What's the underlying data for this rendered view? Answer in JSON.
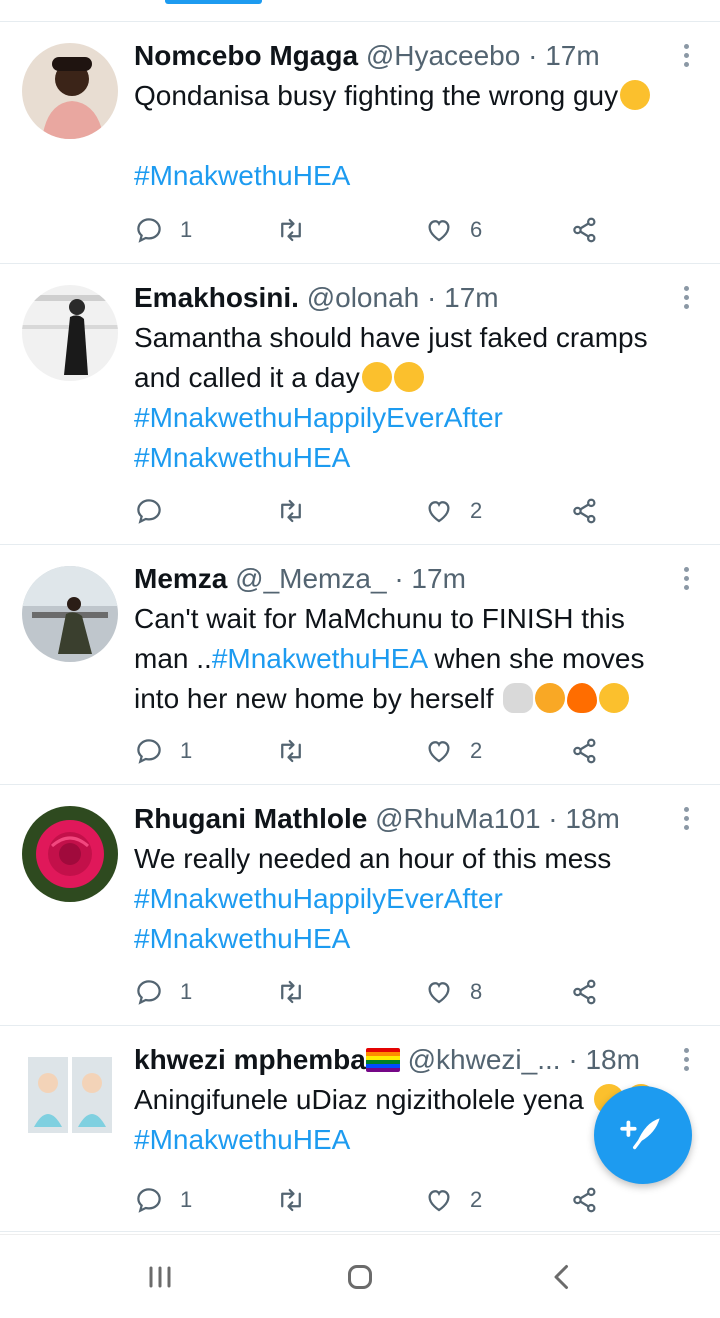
{
  "tweets": [
    {
      "name": "Nomcebo Mgaga",
      "handle": "@Hyaceebo",
      "time": "17m",
      "lines": [
        {
          "text": "Qondanisa busy fighting the wrong guy",
          "emoji": [
            "laugh"
          ]
        },
        {
          "text": "",
          "emoji": []
        },
        {
          "tag": "#MnakwethuHEA"
        }
      ],
      "replies": "1",
      "retweets": "",
      "likes": "6"
    },
    {
      "name": "Emakhosini.",
      "handle": "@olonah",
      "time": "17m",
      "lines": [
        {
          "text": "Samantha should have just faked cramps"
        },
        {
          "text": "and called it a day",
          "emoji": [
            "laugh",
            "laugh"
          ]
        },
        {
          "tag": "#MnakwethuHappilyEverAfter"
        },
        {
          "tag": "#MnakwethuHEA"
        }
      ],
      "replies": "",
      "retweets": "",
      "likes": "2"
    },
    {
      "name": "Memza",
      "handle": "@_Memza_",
      "time": "17m",
      "lines": [
        {
          "text": "Can't wait for MaMchunu to FINISH this"
        },
        {
          "text": "man ..",
          "tag_inline": "#MnakwethuHEA",
          "text_after": " when she moves"
        },
        {
          "text": "into her new home by herself ",
          "emoji": [
            "skull",
            "tired",
            "fire",
            "cry"
          ]
        }
      ],
      "replies": "1",
      "retweets": "",
      "likes": "2"
    },
    {
      "name": "Rhugani Mathlole",
      "handle": "@RhuMa101",
      "time": "18m",
      "lines": [
        {
          "text": "We really needed an hour of this mess"
        },
        {
          "tag": "#MnakwethuHappilyEverAfter"
        },
        {
          "tag": "#MnakwethuHEA"
        }
      ],
      "replies": "1",
      "retweets": "",
      "likes": "8"
    },
    {
      "name": "khwezi mphemba",
      "handle": "@khwezi_...",
      "time": "18m",
      "lines": [
        {
          "text": "Aningifunele uDiaz ngizitholele yena ",
          "emoji": [
            "laugh",
            "laugh"
          ]
        },
        {
          "tag": "#MnakwethuHEA"
        }
      ],
      "replies": "1",
      "retweets": "",
      "likes": "2"
    }
  ],
  "separator": "·",
  "colors": {
    "accent": "#1d9bf0",
    "text": "#0f1419",
    "secondary": "#536471",
    "divider": "#e6ecf0"
  },
  "icons": {
    "reply": "speech-bubble-icon",
    "retweet": "retweet-icon",
    "like": "heart-icon",
    "share": "share-icon",
    "compose": "compose-tweet-icon",
    "more": "more-vertical-icon",
    "nav_recent": "recent-apps-icon",
    "nav_home": "home-icon",
    "nav_back": "back-icon"
  }
}
